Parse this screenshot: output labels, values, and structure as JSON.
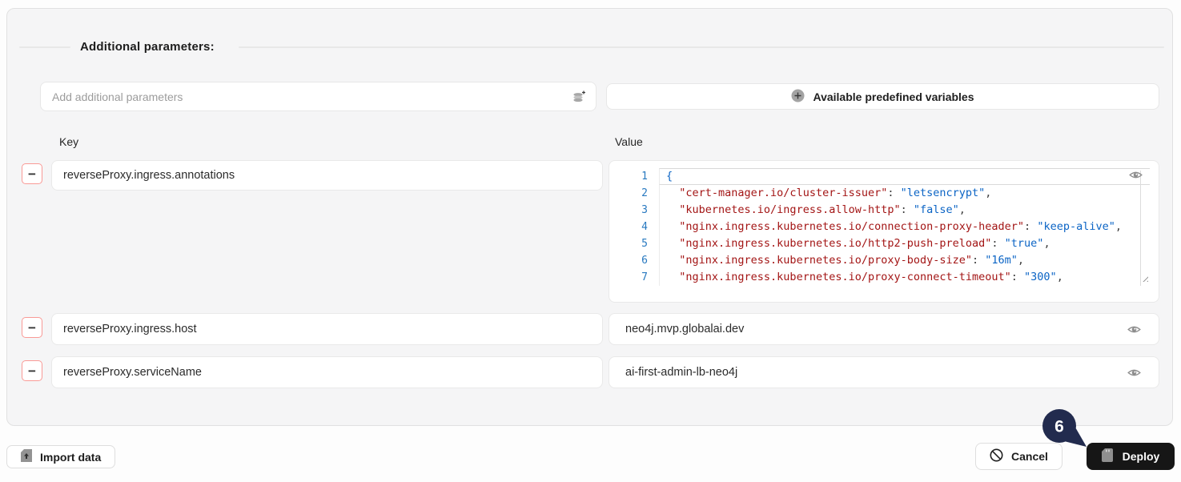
{
  "section": {
    "title": "Additional parameters:"
  },
  "toolbar": {
    "add_input": {
      "placeholder": "Add additional parameters",
      "icon": "layers-plus-icon"
    },
    "predefined_button": {
      "label": "Available predefined variables",
      "icon": "plus-circle-icon"
    }
  },
  "table": {
    "key_header": "Key",
    "value_header": "Value",
    "remove_label": "−",
    "rows": [
      {
        "key": "reverseProxy.ingress.annotations",
        "value_type": "json-editor"
      },
      {
        "key": "reverseProxy.ingress.host",
        "value": "neo4j.mvp.globalai.dev"
      },
      {
        "key": "reverseProxy.serviceName",
        "value": "ai-first-admin-lb-neo4j"
      }
    ]
  },
  "editor": {
    "open_brace": "{",
    "indent": "  ",
    "colon": ": ",
    "comma": ",",
    "lines": [
      {
        "num": "1"
      },
      {
        "num": "2",
        "key": "\"cert-manager.io/cluster-issuer\"",
        "value": "\"letsencrypt\""
      },
      {
        "num": "3",
        "key": "\"kubernetes.io/ingress.allow-http\"",
        "value": "\"false\""
      },
      {
        "num": "4",
        "key": "\"nginx.ingress.kubernetes.io/connection-proxy-header\"",
        "value": "\"keep-alive\""
      },
      {
        "num": "5",
        "key": "\"nginx.ingress.kubernetes.io/http2-push-preload\"",
        "value": "\"true\""
      },
      {
        "num": "6",
        "key": "\"nginx.ingress.kubernetes.io/proxy-body-size\"",
        "value": "\"16m\""
      },
      {
        "num": "7",
        "key": "\"nginx.ingress.kubernetes.io/proxy-connect-timeout\"",
        "value": "\"300\""
      }
    ]
  },
  "footer": {
    "import_label": "Import data",
    "cancel_label": "Cancel",
    "deploy_label": "Deploy"
  },
  "annotation": {
    "badge": "6"
  },
  "colors": {
    "panel_bg": "#f5f5f6",
    "remove_border": "#f99a96",
    "line_number": "#2879c0",
    "code_key": "#a31515",
    "code_value": "#0b64c5",
    "deploy_bg": "#161616",
    "pin": "#222b4e"
  }
}
